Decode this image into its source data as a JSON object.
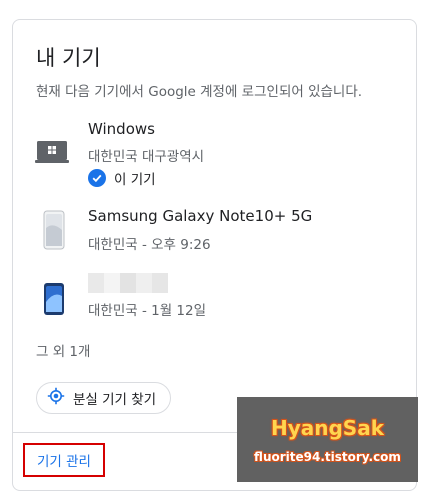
{
  "card": {
    "title": "내 기기",
    "subtitle": "현재 다음 기기에서 Google 계정에 로그인되어 있습니다."
  },
  "devices": [
    {
      "name": "Windows",
      "location": "대한민국 대구광역시",
      "current_label": "이 기기",
      "icon": "laptop-windows-icon"
    },
    {
      "name": "Samsung Galaxy Note10+ 5G",
      "meta": "대한민국 - 오후 9:26",
      "icon": "phone-icon"
    },
    {
      "name": "",
      "meta": "대한민국 - 1월 12일",
      "icon": "phone-icon"
    }
  ],
  "others": "그 외 1개",
  "find_button": {
    "label": "분실 기기 찾기",
    "icon": "location-target-icon"
  },
  "manage_link": "기기 관리",
  "watermark": {
    "title": "HyangSak",
    "subtitle": "fluorite94.tistory.com"
  },
  "colors": {
    "accent": "#1a73e8",
    "highlight": "#d50000"
  }
}
